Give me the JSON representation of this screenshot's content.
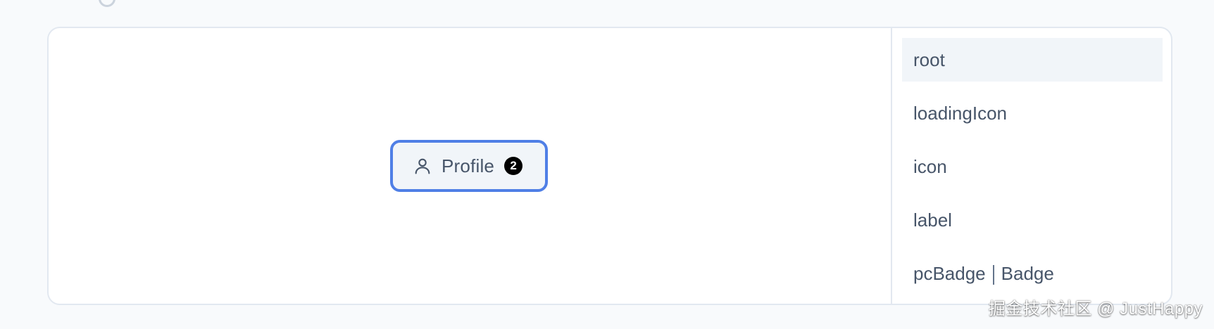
{
  "preview": {
    "button": {
      "label": "Profile",
      "badge": "2",
      "icon": "user-icon"
    }
  },
  "sidebar": {
    "items": [
      {
        "label": "root",
        "active": true
      },
      {
        "label": "loadingIcon",
        "active": false
      },
      {
        "label": "icon",
        "active": false
      },
      {
        "label": "label",
        "active": false
      },
      {
        "label": "pcBadge",
        "suffix": "Badge",
        "active": false
      }
    ]
  },
  "watermark": "掘金技术社区 @ JustHappy",
  "colors": {
    "focus_ring": "#4f7fe6",
    "button_bg": "#f1f5f9",
    "active_item_bg": "#f1f5f9",
    "text": "#475569",
    "badge_bg": "#000000"
  }
}
